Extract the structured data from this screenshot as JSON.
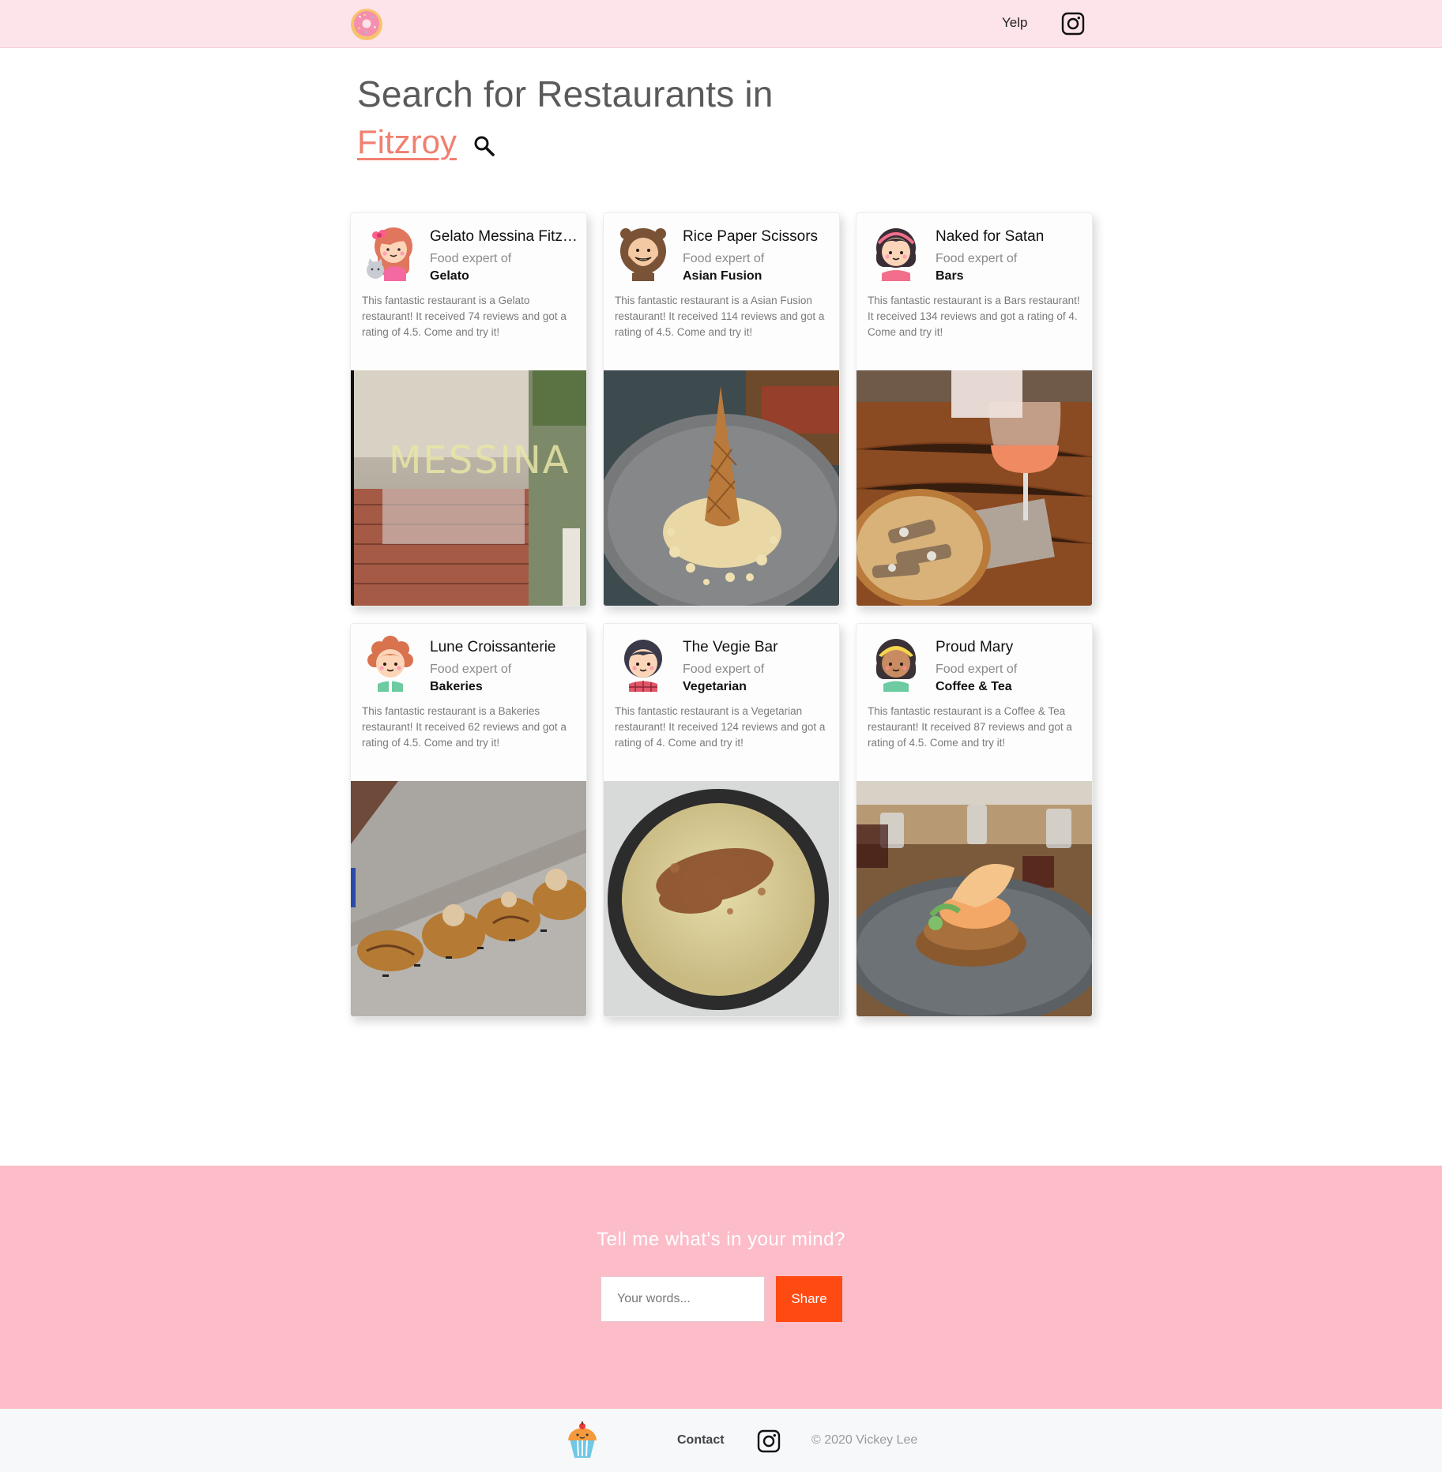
{
  "header": {
    "logo_icon": "donut-icon",
    "nav_yelp": "Yelp",
    "nav_instagram_icon": "instagram-icon"
  },
  "hero": {
    "title": "Search for Restaurants in",
    "city": "Fitzroy",
    "search_icon": "search-icon"
  },
  "cards": [
    {
      "name": "Gelato Messina Fitzroy",
      "expert_label": "Food expert of",
      "category": "Gelato",
      "description": "This fantastic restaurant is a Gelato restaurant! It received 74 reviews and got a rating of 4.5. Come and try it!",
      "avatar_icon": "girl-with-cat-avatar-icon",
      "photo": "messina-storefront-photo"
    },
    {
      "name": "Rice Paper Scissors",
      "expert_label": "Food expert of",
      "category": "Asian Fusion",
      "description": "This fantastic restaurant is a Asian Fusion restaurant! It received 114 reviews and got a rating of 4.5. Come and try it!",
      "avatar_icon": "bear-hood-avatar-icon",
      "photo": "ice-cream-cone-dessert-photo"
    },
    {
      "name": "Naked for Satan",
      "expert_label": "Food expert of",
      "category": "Bars",
      "description": "This fantastic restaurant is a Bars restaurant! It received 134 reviews and got a rating of 4. Come and try it!",
      "avatar_icon": "girl-headband-avatar-icon",
      "photo": "wine-and-pintxos-photo"
    },
    {
      "name": "Lune Croissanterie",
      "expert_label": "Food expert of",
      "category": "Bakeries",
      "description": "This fantastic restaurant is a Bakeries restaurant! It received 62 reviews and got a rating of 4.5. Come and try it!",
      "avatar_icon": "curly-hair-avatar-icon",
      "photo": "croissants-photo"
    },
    {
      "name": "The Vegie Bar",
      "expert_label": "Food expert of",
      "category": "Vegetarian",
      "description": "This fantastic restaurant is a Vegetarian restaurant! It received 124 reviews and got a rating of 4. Come and try it!",
      "avatar_icon": "boy-plaid-avatar-icon",
      "photo": "latte-cup-photo"
    },
    {
      "name": "Proud Mary",
      "expert_label": "Food expert of",
      "category": "Coffee & Tea",
      "description": "This fantastic restaurant is a Coffee & Tea restaurant! It received 87 reviews and got a rating of 4.5. Come and try it!",
      "avatar_icon": "girl-yellow-headband-avatar-icon",
      "photo": "brunch-plate-photo"
    }
  ],
  "feedback": {
    "title": "Tell me what's in your mind?",
    "input_placeholder": "Your words...",
    "input_value": "",
    "share_label": "Share"
  },
  "footer": {
    "logo_icon": "cupcake-icon",
    "contact": "Contact",
    "instagram_icon": "instagram-icon",
    "copyright": "© 2020 Vickey Lee"
  },
  "colors": {
    "topbar_bg": "#fde4ea",
    "accent": "#f08070",
    "feedback_bg": "#fcbdc9",
    "share_button": "#ff4a12",
    "footer_bg": "#f7f8fa"
  }
}
